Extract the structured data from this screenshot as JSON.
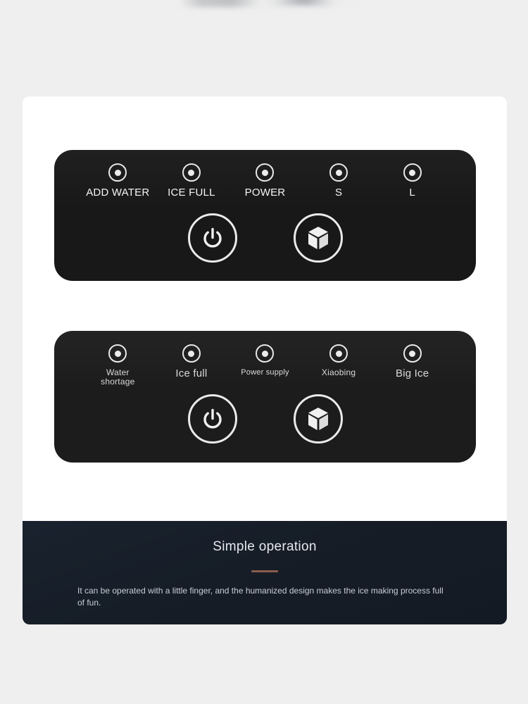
{
  "card": {
    "panel_top": {
      "name": "control-panel-english",
      "indicators": [
        {
          "icon": "led-indicator-icon",
          "label": "ADD WATER"
        },
        {
          "icon": "led-indicator-icon",
          "label": "ICE FULL"
        },
        {
          "icon": "led-indicator-icon",
          "label": "POWER"
        },
        {
          "icon": "led-indicator-icon",
          "label": "S"
        },
        {
          "icon": "led-indicator-icon",
          "label": "L"
        }
      ],
      "buttons": [
        {
          "icon": "power-icon",
          "name": "power-button"
        },
        {
          "icon": "ice-cube-icon",
          "name": "ice-cube-button"
        }
      ]
    },
    "panel_bottom": {
      "name": "control-panel-translated",
      "indicators": [
        {
          "icon": "led-indicator-icon",
          "label": "Water\nshortage",
          "size": "sz-md"
        },
        {
          "icon": "led-indicator-icon",
          "label": "Ice full",
          "size": "sz-lg"
        },
        {
          "icon": "led-indicator-icon",
          "label": "Power supply",
          "size": "sz-sm"
        },
        {
          "icon": "led-indicator-icon",
          "label": "Xiaobing",
          "size": "sz-md"
        },
        {
          "icon": "led-indicator-icon",
          "label": "Big Ice",
          "size": "sz-lg"
        }
      ],
      "buttons": [
        {
          "icon": "power-icon",
          "name": "power-button"
        },
        {
          "icon": "ice-cube-icon",
          "name": "ice-cube-button"
        }
      ]
    }
  },
  "feature_strip": {
    "title": "Simple operation",
    "body": "It can be operated with a little finger, and the humanized design makes the ice making process full of fun.",
    "divider_color": "#8a5c4c",
    "background_color": "#161d27"
  },
  "colors": {
    "page_background": "#efefef",
    "card_background": "#ffffff",
    "panel_background": "#181818",
    "led_color": "#ececec"
  }
}
